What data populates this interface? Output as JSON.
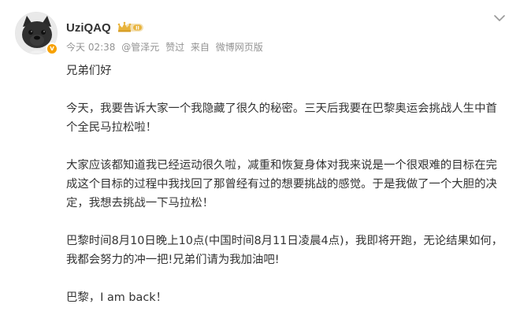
{
  "header": {
    "username": "UziQAQ",
    "timestamp": "今天 02:38",
    "at_mention": "@管泽元",
    "liked_label": "赞过",
    "source_prefix": "来自",
    "source": "微博网页版"
  },
  "icons": {
    "avatar": "french-bulldog-avatar",
    "verified": "orange-v-verified-icon",
    "vip": "crown-vip-badge-icon",
    "menu": "chevron-down-icon"
  },
  "colors": {
    "text": "#333333",
    "meta": "#939393",
    "verified_orange": "#f7a100",
    "vip_gold": "#e8b33c"
  },
  "post": {
    "paragraphs": [
      "兄弟们好",
      "今天，我要告诉大家一个我隐藏了很久的秘密。三天后我要在巴黎奥运会挑战人生中首个全民马拉松啦！",
      "大家应该都知道我已经运动很久啦，减重和恢复身体对我来说是一个很艰难的目标在完成这个目标的过程中我找回了那曾经有过的想要挑战的感觉。于是我做了一个大胆的决定，我想去挑战一下马拉松！",
      "巴黎时间8月10日晚上10点(中国时间8月11日凌晨4点)，我即将开跑，无论结果如何，我都会努力的冲一把!兄弟们请为我加油吧!",
      "巴黎，I am back！"
    ]
  }
}
